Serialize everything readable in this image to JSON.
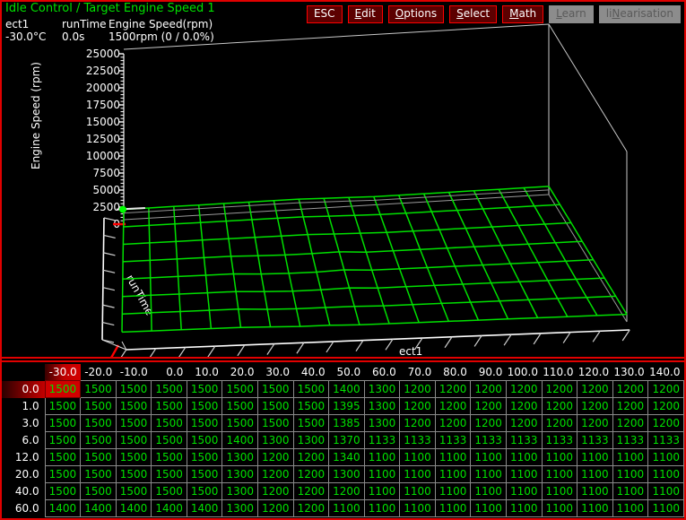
{
  "window": {
    "title": "Idle Control / Target Engine Speed 1",
    "title_color": "#00e000",
    "border_color": "#e00000",
    "background": "#000000"
  },
  "readouts": [
    {
      "name": "ect1",
      "value": "-30.0°C"
    },
    {
      "name": "runTime",
      "value": "0.0s"
    },
    {
      "name": "Engine Speed(rpm)",
      "value": "1500rpm (0 / 0.0%)"
    }
  ],
  "toolbar": {
    "buttons": [
      {
        "label": "ESC",
        "accel": "",
        "enabled": true
      },
      {
        "label": "Edit",
        "accel": "E",
        "enabled": true
      },
      {
        "label": "Options",
        "accel": "O",
        "enabled": true
      },
      {
        "label": "Select",
        "accel": "S",
        "enabled": true
      },
      {
        "label": "Math",
        "accel": "M",
        "enabled": true
      },
      {
        "label": "Learn",
        "accel": "L",
        "enabled": false
      },
      {
        "label": "liNearisation",
        "accel": "N",
        "enabled": false
      }
    ]
  },
  "plot": {
    "y_axis_label": "Engine Speed (rpm)",
    "x_axis_label": "ect1",
    "z_axis_label": "runTime",
    "y_ticks": [
      25000,
      22500,
      20000,
      17500,
      15000,
      12500,
      10000,
      7500,
      5000,
      2500,
      0
    ],
    "y_tick_labels": [
      "25000",
      "22500",
      "20000",
      "17500",
      "15000",
      "12500",
      "10000",
      "7500",
      "5000",
      "2500",
      "0"
    ],
    "y_min": 0,
    "y_max": 25000,
    "minor_ticks_per_major": 5,
    "surface_color": "#00e000",
    "box_color": "#c8c8c8",
    "floor_axis_color": "#ffffff",
    "cursor_marker_color": "#00ff00",
    "origin_tick_color": "#ff0000"
  },
  "chart_data": {
    "type": "surface",
    "title": "Idle Control / Target Engine Speed 1",
    "xlabel": "ect1",
    "ylabel": "Engine Speed (rpm)",
    "zlabel": "runTime",
    "ylim": [
      0,
      25000
    ],
    "grid": false,
    "legend": "none",
    "x": [
      -30.0,
      -20.0,
      -10.0,
      0.0,
      10.0,
      20.0,
      30.0,
      40.0,
      50.0,
      60.0,
      70.0,
      80.0,
      90.0,
      100.0,
      110.0,
      120.0,
      130.0,
      140.0
    ],
    "z": [
      0.0,
      1.0,
      3.0,
      6.0,
      12.0,
      20.0,
      40.0,
      60.0
    ],
    "values": [
      [
        1500,
        1500,
        1500,
        1500,
        1500,
        1500,
        1500,
        1500,
        1400,
        1300,
        1200,
        1200,
        1200,
        1200,
        1200,
        1200,
        1200,
        1200
      ],
      [
        1500,
        1500,
        1500,
        1500,
        1500,
        1500,
        1500,
        1500,
        1395,
        1300,
        1200,
        1200,
        1200,
        1200,
        1200,
        1200,
        1200,
        1200
      ],
      [
        1500,
        1500,
        1500,
        1500,
        1500,
        1500,
        1500,
        1500,
        1385,
        1300,
        1200,
        1200,
        1200,
        1200,
        1200,
        1200,
        1200,
        1200
      ],
      [
        1500,
        1500,
        1500,
        1500,
        1500,
        1400,
        1300,
        1300,
        1370,
        1133,
        1133,
        1133,
        1133,
        1133,
        1133,
        1133,
        1133,
        1133
      ],
      [
        1500,
        1500,
        1500,
        1500,
        1500,
        1300,
        1200,
        1200,
        1340,
        1100,
        1100,
        1100,
        1100,
        1100,
        1100,
        1100,
        1100,
        1100
      ],
      [
        1500,
        1500,
        1500,
        1500,
        1500,
        1300,
        1200,
        1200,
        1300,
        1100,
        1100,
        1100,
        1100,
        1100,
        1100,
        1100,
        1100,
        1100
      ],
      [
        1500,
        1500,
        1500,
        1500,
        1500,
        1300,
        1200,
        1200,
        1200,
        1100,
        1100,
        1100,
        1100,
        1100,
        1100,
        1100,
        1100,
        1100
      ],
      [
        1400,
        1400,
        1400,
        1400,
        1400,
        1300,
        1200,
        1200,
        1100,
        1100,
        1100,
        1100,
        1100,
        1100,
        1100,
        1100,
        1100,
        1100
      ]
    ]
  },
  "table": {
    "corner_label": "",
    "col_headers": [
      "-30.0",
      "-20.0",
      "-10.0",
      "0.0",
      "10.0",
      "20.0",
      "30.0",
      "40.0",
      "50.0",
      "60.0",
      "70.0",
      "80.0",
      "90.0",
      "100.0",
      "110.0",
      "120.0",
      "130.0",
      "140.0"
    ],
    "row_headers": [
      "0.0",
      "1.0",
      "3.0",
      "6.0",
      "12.0",
      "20.0",
      "40.0",
      "60.0"
    ],
    "rows": [
      [
        "1500",
        "1500",
        "1500",
        "1500",
        "1500",
        "1500",
        "1500",
        "1500",
        "1400",
        "1300",
        "1200",
        "1200",
        "1200",
        "1200",
        "1200",
        "1200",
        "1200",
        "1200"
      ],
      [
        "1500",
        "1500",
        "1500",
        "1500",
        "1500",
        "1500",
        "1500",
        "1500",
        "1395",
        "1300",
        "1200",
        "1200",
        "1200",
        "1200",
        "1200",
        "1200",
        "1200",
        "1200"
      ],
      [
        "1500",
        "1500",
        "1500",
        "1500",
        "1500",
        "1500",
        "1500",
        "1500",
        "1385",
        "1300",
        "1200",
        "1200",
        "1200",
        "1200",
        "1200",
        "1200",
        "1200",
        "1200"
      ],
      [
        "1500",
        "1500",
        "1500",
        "1500",
        "1500",
        "1400",
        "1300",
        "1300",
        "1370",
        "1133",
        "1133",
        "1133",
        "1133",
        "1133",
        "1133",
        "1133",
        "1133",
        "1133"
      ],
      [
        "1500",
        "1500",
        "1500",
        "1500",
        "1500",
        "1300",
        "1200",
        "1200",
        "1340",
        "1100",
        "1100",
        "1100",
        "1100",
        "1100",
        "1100",
        "1100",
        "1100",
        "1100"
      ],
      [
        "1500",
        "1500",
        "1500",
        "1500",
        "1500",
        "1300",
        "1200",
        "1200",
        "1300",
        "1100",
        "1100",
        "1100",
        "1100",
        "1100",
        "1100",
        "1100",
        "1100",
        "1100"
      ],
      [
        "1500",
        "1500",
        "1500",
        "1500",
        "1500",
        "1300",
        "1200",
        "1200",
        "1200",
        "1100",
        "1100",
        "1100",
        "1100",
        "1100",
        "1100",
        "1100",
        "1100",
        "1100"
      ],
      [
        "1400",
        "1400",
        "1400",
        "1400",
        "1400",
        "1300",
        "1200",
        "1200",
        "1100",
        "1100",
        "1100",
        "1100",
        "1100",
        "1100",
        "1100",
        "1100",
        "1100",
        "1100"
      ]
    ],
    "selected_row": 0,
    "selected_col": 0,
    "value_color": "#00e000",
    "header_color": "#ffffff",
    "selection_color": "#d00000",
    "gridline_color": "#8a8a8a"
  }
}
